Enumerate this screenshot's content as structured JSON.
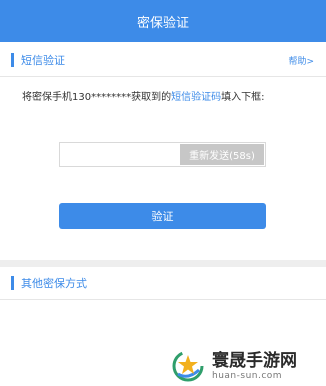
{
  "header": {
    "title": "密保验证"
  },
  "sms_section": {
    "title": "短信验证",
    "help_link": "帮助>",
    "desc_prefix": "将密保手机130********获取到的",
    "desc_highlight": "短信验证码",
    "desc_suffix": "填入下框:",
    "code_input": {
      "value": "",
      "placeholder": ""
    },
    "resend_label": "重新发送(58s)",
    "verify_label": "验证"
  },
  "other_section": {
    "title": "其他密保方式"
  },
  "watermark": {
    "title": "寰晟手游网",
    "url": "huan-sun.com"
  },
  "colors": {
    "accent": "#3d8be8",
    "disabled": "#c7c7c7",
    "band": "#eeeeee"
  },
  "icons": {
    "watermark_logo": "star-swirl-logo-icon"
  }
}
